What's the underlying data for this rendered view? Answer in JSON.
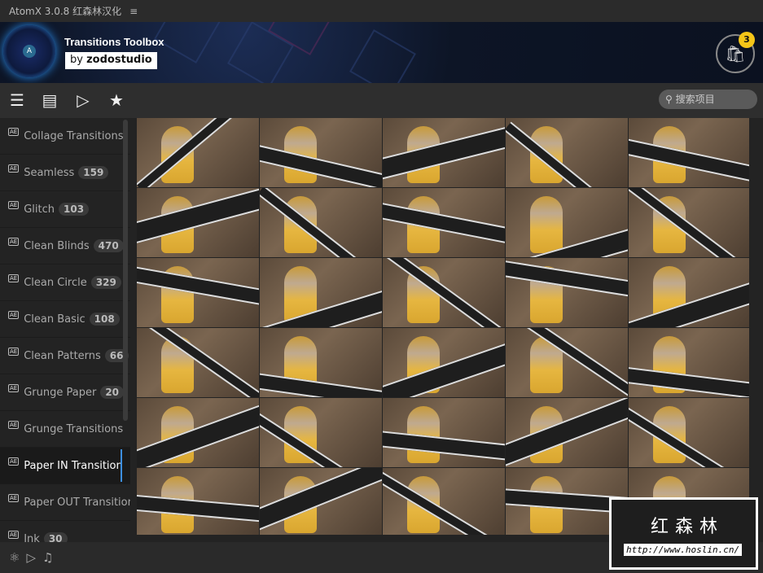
{
  "titlebar": {
    "title": "AtomX 3.0.8 红森林汉化",
    "menu_icon": "≡"
  },
  "banner": {
    "app_title": "Transitions Toolbox",
    "by": "by",
    "author": "zodostudio",
    "cart_count": "3"
  },
  "toolbar": {
    "search_placeholder": "搜索项目"
  },
  "sidebar": {
    "items": [
      {
        "label": "Collage Transitions",
        "count": ""
      },
      {
        "label": "Seamless",
        "count": "159"
      },
      {
        "label": "Glitch",
        "count": "103"
      },
      {
        "label": "Clean Blinds",
        "count": "470"
      },
      {
        "label": "Clean Circle",
        "count": "329"
      },
      {
        "label": "Clean Basic",
        "count": "108"
      },
      {
        "label": "Clean Patterns",
        "count": "66"
      },
      {
        "label": "Grunge Paper",
        "count": "20"
      },
      {
        "label": "Grunge Transitions",
        "count": ""
      },
      {
        "label": "Paper IN Transition",
        "count": "",
        "active": true
      },
      {
        "label": "Paper OUT Transition",
        "count": ""
      },
      {
        "label": "Ink",
        "count": "30"
      }
    ]
  },
  "grid": {
    "thumbnail_count": 30
  },
  "watermark": {
    "text": "红森林",
    "url": "http://www.hoslin.cn/"
  },
  "colors": {
    "accent": "#3d8fe0",
    "badge": "#f5c518"
  }
}
